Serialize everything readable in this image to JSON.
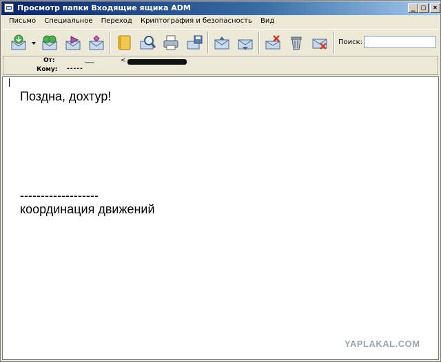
{
  "window": {
    "title": "Просмотр папки Входящие ящика ADM"
  },
  "menu": {
    "items": [
      {
        "label": "Письмо"
      },
      {
        "label": "Специальное"
      },
      {
        "label": "Переход"
      },
      {
        "label": "Криптография и безопасность"
      },
      {
        "label": "Вид"
      }
    ]
  },
  "toolbar": {
    "search_label": "Поиск:",
    "search_value": ""
  },
  "header": {
    "from_label": "От:",
    "from_name": "___",
    "from_email": "<",
    "to_label": "Кому:",
    "to_value": "-----"
  },
  "message": {
    "line1": "Поздна, дохтур!",
    "line2": "-------------------",
    "line3": "координация движений"
  },
  "watermark": "YAPLAKAL.COM",
  "colors": {
    "titlebar_start": "#0a246a",
    "titlebar_end": "#a6caf0",
    "chrome": "#ece9d8",
    "body_bg": "#ffffff"
  }
}
